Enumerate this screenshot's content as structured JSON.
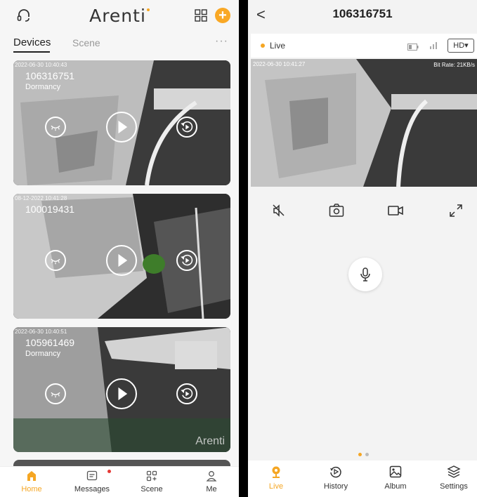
{
  "left": {
    "brand": "Arenti",
    "tabs": {
      "devices": "Devices",
      "scene": "Scene",
      "more": "···"
    },
    "add_symbol": "+",
    "devices": [
      {
        "timestamp": "2022-06-30 10:40:43",
        "name": "106316751",
        "status": "Dormancy"
      },
      {
        "timestamp": "08-12-2022 10:41:28",
        "name": "100019431",
        "status": ""
      },
      {
        "timestamp": "2022-06-30 10:40:51",
        "name": "105961469",
        "status": "Dormancy"
      }
    ],
    "watermark": "Arenti",
    "nav": [
      {
        "label": "Home",
        "icon": "home-icon",
        "active": true
      },
      {
        "label": "Messages",
        "icon": "messages-icon",
        "active": false
      },
      {
        "label": "Scene",
        "icon": "scene-icon",
        "active": false
      },
      {
        "label": "Me",
        "icon": "me-icon",
        "active": false
      }
    ],
    "colors": {
      "accent": "#f5a623",
      "badge": "#e53935"
    }
  },
  "right": {
    "title": "106316751",
    "back_symbol": "<",
    "live_label": "Live",
    "quality": "HD▾",
    "video_timestamp": "2022-06-30 10:41:27",
    "bitrate": "Bit Rate: 21KB/s",
    "nav": [
      {
        "label": "Live",
        "icon": "live-icon",
        "active": true
      },
      {
        "label": "History",
        "icon": "history-icon",
        "active": false
      },
      {
        "label": "Album",
        "icon": "album-icon",
        "active": false
      },
      {
        "label": "Settings",
        "icon": "settings-icon",
        "active": false
      }
    ]
  }
}
